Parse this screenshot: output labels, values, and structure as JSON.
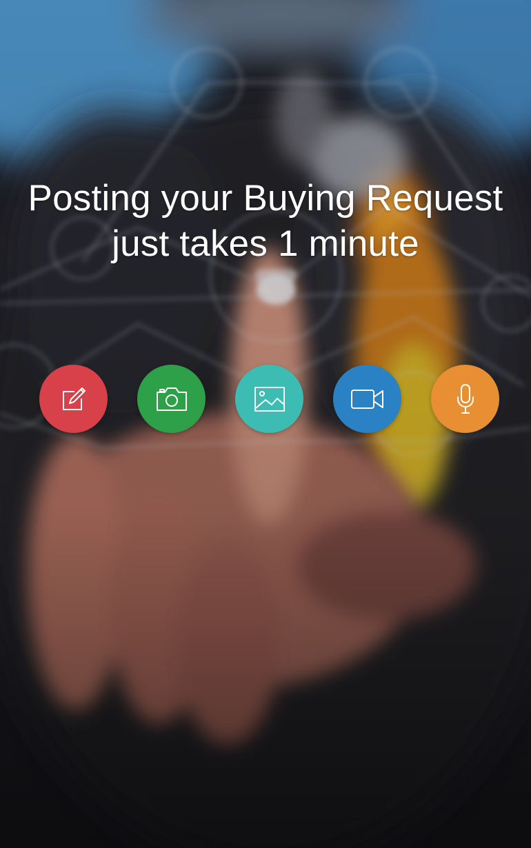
{
  "headline": {
    "line1": "Posting your Buying Request",
    "line2": "just takes 1 minute"
  },
  "actions": [
    {
      "name": "text",
      "icon": "edit-icon",
      "color": "#d9414a"
    },
    {
      "name": "camera",
      "icon": "camera-icon",
      "color": "#2ea04a"
    },
    {
      "name": "gallery",
      "icon": "image-icon",
      "color": "#3cbcb2"
    },
    {
      "name": "video",
      "icon": "video-icon",
      "color": "#2a82c4"
    },
    {
      "name": "voice",
      "icon": "microphone-icon",
      "color": "#e98f33"
    }
  ],
  "background": {
    "description_colors": {
      "sky": "#4a87b8",
      "suit": "#1b1b22",
      "skin": "#c9907a",
      "tie": "#e39a2a"
    }
  }
}
